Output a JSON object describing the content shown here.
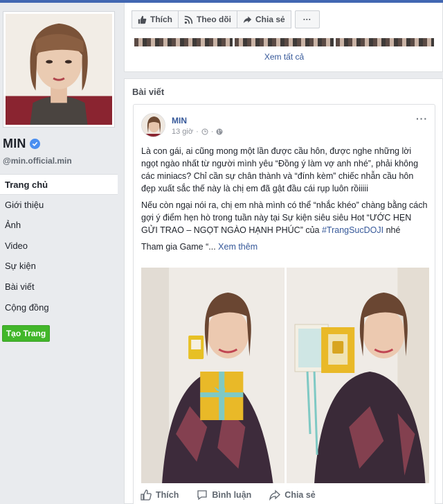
{
  "page": {
    "name": "MIN",
    "handle": "@min.official.min"
  },
  "nav": {
    "items": [
      {
        "label": "Trang chủ"
      },
      {
        "label": "Giới thiệu"
      },
      {
        "label": "Ảnh"
      },
      {
        "label": "Video"
      },
      {
        "label": "Sự kiện"
      },
      {
        "label": "Bài viết"
      },
      {
        "label": "Cộng đồng"
      }
    ],
    "create_page_label": "Tạo Trang"
  },
  "toolbar": {
    "like_label": "Thích",
    "follow_label": "Theo dõi",
    "share_label": "Chia sẻ",
    "more_label": "···"
  },
  "photos": {
    "see_all_label": "Xem tất cả"
  },
  "posts": {
    "header": "Bài viết",
    "post": {
      "author": "MIN",
      "time": "13 giờ",
      "menu_label": "···",
      "paragraph1": "Là con gái, ai cũng mong một lần được cầu hôn, được nghe những lời ngọt ngào nhất từ người mình yêu “Đồng ý làm vợ anh nhé”, phải không các miniacs? Chỉ cần sự chân thành và “đính kèm” chiếc nhẫn cầu hôn đẹp xuất sắc thế này là chị em đã gật đầu cái rụp luôn rồiiiii",
      "paragraph2_text": "Nếu còn ngại nói ra, chị em nhà mình có thể “nhắc khéo” chàng bằng cách gợi ý điểm hẹn hò trong tuần này tại Sự kiện siêu siêu Hot “ƯỚC HẸN GỬI TRAO – NGỌT NGÀO HẠNH PHÚC” của ",
      "paragraph2_hashtag": "#TrangSucDOJI",
      "paragraph2_end": " nhé",
      "paragraph3_text": "Tham gia Game “...",
      "see_more_label": " Xem thêm",
      "like_label": "Thích",
      "comment_label": "Bình luận",
      "share_label": "Chia sẻ"
    }
  },
  "colors": {
    "brand": "#4267b2",
    "link": "#365899",
    "create_button": "#42b72a",
    "verified": "#4b8ff0"
  }
}
